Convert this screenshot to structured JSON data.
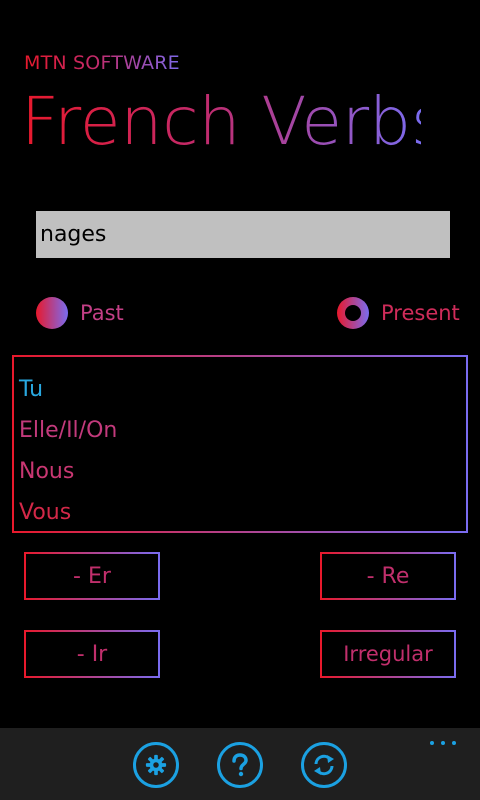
{
  "header": {
    "brand": "MTN SOFTWARE",
    "title": "French Verbs"
  },
  "search": {
    "value": "nages"
  },
  "tense": {
    "past_label": "Past",
    "present_label": "Present",
    "selected": "Present"
  },
  "conjugations": [
    {
      "pronoun": "Tu"
    },
    {
      "pronoun": "Elle/Il/On"
    },
    {
      "pronoun": "Nous"
    },
    {
      "pronoun": "Vous"
    }
  ],
  "buttons": {
    "er": "- Er",
    "re": "- Re",
    "ir": "- Ir",
    "irregular": "Irregular"
  },
  "appbar": {
    "icons": [
      "settings-icon",
      "help-icon",
      "sync-icon"
    ],
    "more": "more-ellipsis"
  },
  "colors": {
    "gradient_start": "#e8192c",
    "gradient_end": "#7a6cf0",
    "accent": "#1ba1e2",
    "appbar_bg": "#1f1f1f",
    "input_bg": "#c0c0c0"
  }
}
